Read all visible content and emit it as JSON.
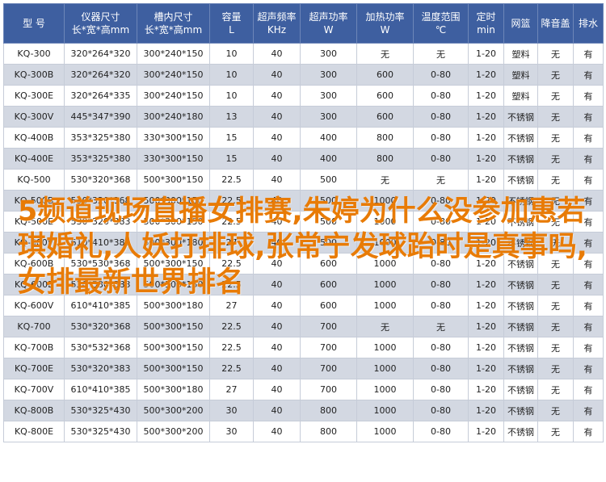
{
  "table": {
    "headers": [
      {
        "lines": [
          "型 号"
        ]
      },
      {
        "lines": [
          "仪器尺寸",
          "长*宽*高mm"
        ]
      },
      {
        "lines": [
          "槽内尺寸",
          "长*宽*高mm"
        ]
      },
      {
        "lines": [
          "容量",
          "L"
        ]
      },
      {
        "lines": [
          "超声频率",
          "KHz"
        ]
      },
      {
        "lines": [
          "超声功率",
          "W"
        ]
      },
      {
        "lines": [
          "加热功率",
          "W"
        ]
      },
      {
        "lines": [
          "温度范围",
          "℃"
        ]
      },
      {
        "lines": [
          "定时",
          "min"
        ]
      },
      {
        "lines": [
          "网篮"
        ]
      },
      {
        "lines": [
          "降音盖"
        ]
      },
      {
        "lines": [
          "排水"
        ]
      }
    ],
    "rows": [
      [
        "KQ-300",
        "320*264*320",
        "300*240*150",
        "10",
        "40",
        "300",
        "无",
        "无",
        "1-20",
        "塑料",
        "无",
        "有"
      ],
      [
        "KQ-300B",
        "320*264*320",
        "300*240*150",
        "10",
        "40",
        "300",
        "600",
        "0-80",
        "1-20",
        "塑料",
        "无",
        "有"
      ],
      [
        "KQ-300E",
        "320*264*335",
        "300*240*150",
        "10",
        "40",
        "300",
        "600",
        "0-80",
        "1-20",
        "塑料",
        "无",
        "有"
      ],
      [
        "KQ-300V",
        "445*347*390",
        "300*240*180",
        "13",
        "40",
        "300",
        "600",
        "0-80",
        "1-20",
        "不锈钢",
        "无",
        "有"
      ],
      [
        "KQ-400B",
        "353*325*380",
        "330*300*150",
        "15",
        "40",
        "400",
        "800",
        "0-80",
        "1-20",
        "不锈钢",
        "无",
        "有"
      ],
      [
        "KQ-400E",
        "353*325*380",
        "330*300*150",
        "15",
        "40",
        "400",
        "800",
        "0-80",
        "1-20",
        "不锈钢",
        "无",
        "有"
      ],
      [
        "KQ-500",
        "530*320*368",
        "500*300*150",
        "22.5",
        "40",
        "500",
        "无",
        "无",
        "1-20",
        "不锈钢",
        "无",
        "有"
      ],
      [
        "KQ-500B",
        "530*320*368",
        "500*300*150",
        "22.5",
        "40",
        "500",
        "1000",
        "0-80",
        "1-20",
        "不锈钢",
        "无",
        "有"
      ],
      [
        "KQ-500E",
        "530*320*383",
        "500*300*150",
        "22.5",
        "40",
        "500",
        "1000",
        "0-80",
        "1-20",
        "不锈钢",
        "无",
        "有"
      ],
      [
        "KQ-500V",
        "610*410*385",
        "500*300*180",
        "27",
        "40",
        "500",
        "1000",
        "0-80",
        "1-20",
        "不锈钢",
        "无",
        "有"
      ],
      [
        "KQ-600B",
        "530*530*368",
        "500*300*150",
        "22.5",
        "40",
        "600",
        "1000",
        "0-80",
        "1-20",
        "不锈钢",
        "无",
        "有"
      ],
      [
        "KQ-600E",
        "530*530*383",
        "500*300*150",
        "22.5",
        "40",
        "600",
        "1000",
        "0-80",
        "1-20",
        "不锈钢",
        "无",
        "有"
      ],
      [
        "KQ-600V",
        "610*410*385",
        "500*300*180",
        "27",
        "40",
        "600",
        "1000",
        "0-80",
        "1-20",
        "不锈钢",
        "无",
        "有"
      ],
      [
        "KQ-700",
        "530*320*368",
        "500*300*150",
        "22.5",
        "40",
        "700",
        "无",
        "无",
        "1-20",
        "不锈钢",
        "无",
        "有"
      ],
      [
        "KQ-700B",
        "530*532*368",
        "500*300*150",
        "22.5",
        "40",
        "700",
        "1000",
        "0-80",
        "1-20",
        "不锈钢",
        "无",
        "有"
      ],
      [
        "KQ-700E",
        "530*320*383",
        "500*300*150",
        "22.5",
        "40",
        "700",
        "1000",
        "0-80",
        "1-20",
        "不锈钢",
        "无",
        "有"
      ],
      [
        "KQ-700V",
        "610*410*385",
        "500*300*180",
        "27",
        "40",
        "700",
        "1000",
        "0-80",
        "1-20",
        "不锈钢",
        "无",
        "有"
      ],
      [
        "KQ-800B",
        "530*325*430",
        "500*300*200",
        "30",
        "40",
        "800",
        "1000",
        "0-80",
        "1-20",
        "不锈钢",
        "无",
        "有"
      ],
      [
        "KQ-800E",
        "530*325*430",
        "500*300*200",
        "30",
        "40",
        "800",
        "1000",
        "0-80",
        "1-20",
        "不锈钢",
        "无",
        "有"
      ]
    ]
  },
  "overlay_text": "5频道现场直播女排赛,朱婷为什么没参加惠若琪婚礼,人妖打排球,张常宁发球跆时是真事吗,女排最新世界排名",
  "colors": {
    "header_bg": "#3e5fa0",
    "header_text": "#ffffff",
    "row_alt_bg": "#d3d8e2",
    "overlay_text": "#e87b06"
  }
}
